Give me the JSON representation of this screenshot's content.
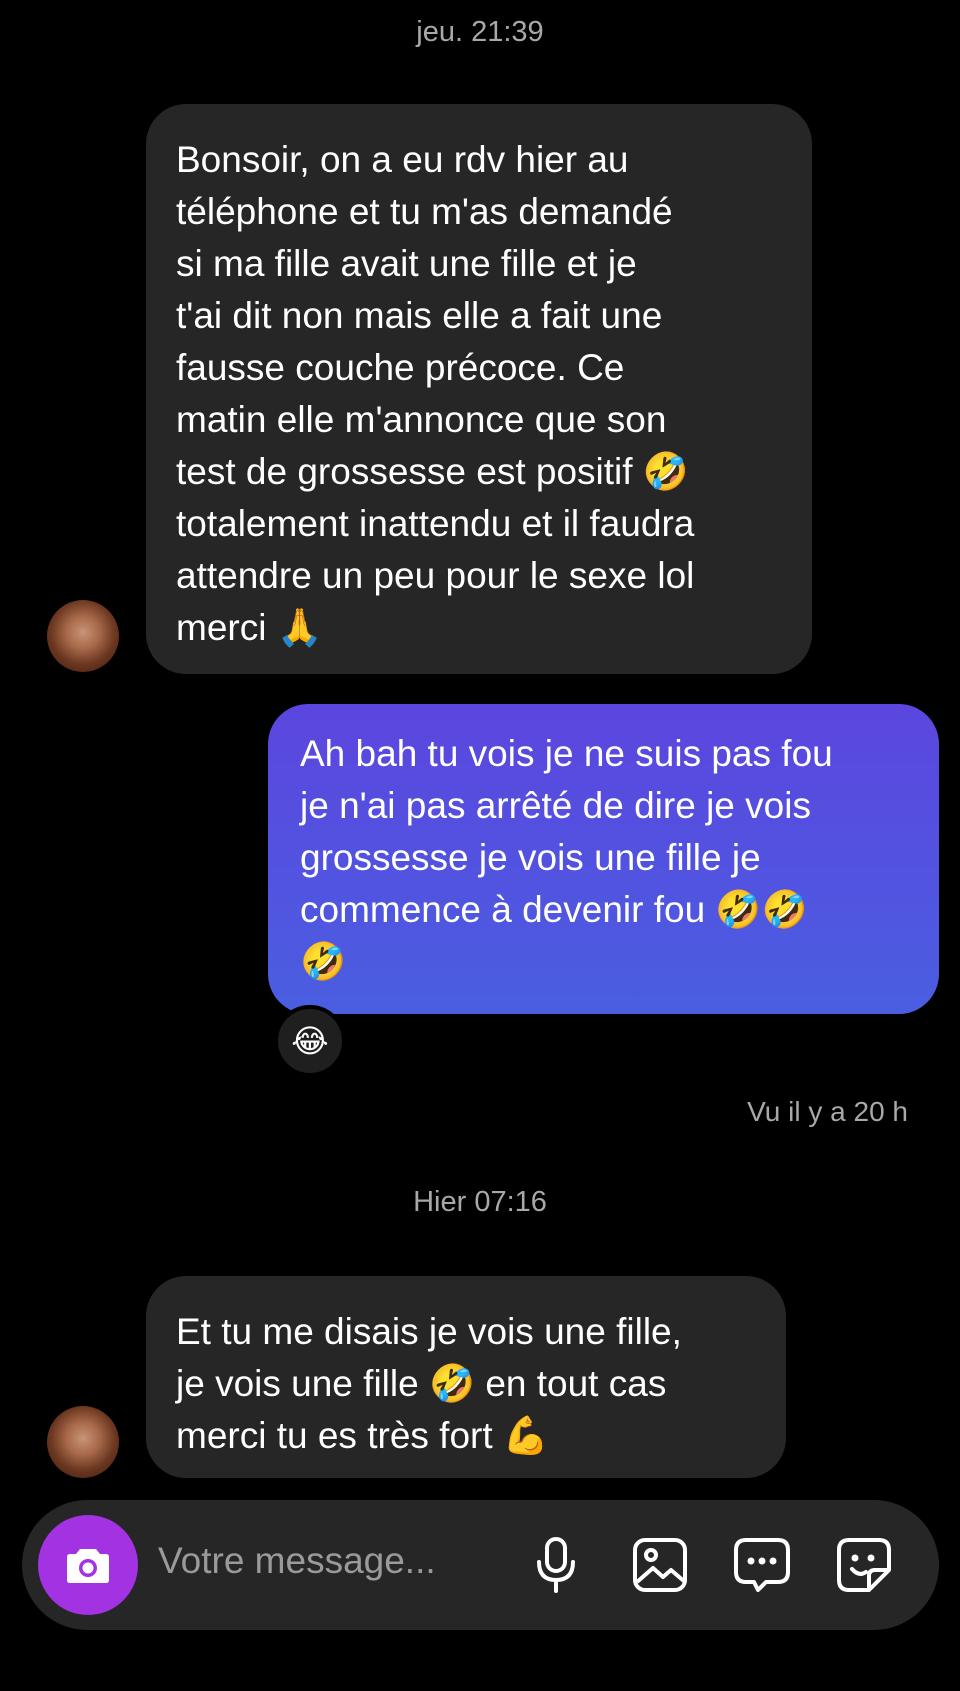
{
  "thread": {
    "timestamp_1": "jeu. 21:39",
    "timestamp_2": "Hier 07:16",
    "seen_status": "Vu il y a 20 h"
  },
  "messages": [
    {
      "direction": "incoming",
      "text": "Bonsoir, on a eu rdv hier au\ntéléphone et tu m'as demandé\nsi ma fille avait une fille et je\nt'ai dit non mais elle a fait une\nfausse couche précoce. Ce\nmatin elle m'annonce que son\ntest de grossesse est positif 🤣\ntotalement inattendu et il faudra\nattendre un peu pour le sexe lol\nmerci 🙏"
    },
    {
      "direction": "outgoing",
      "text": "Ah bah tu vois je ne suis pas fou\nje n'ai pas arrêté de dire je vois\ngrossesse je vois une fille je\ncommence à devenir fou 🤣🤣\n🤣",
      "reaction": "😂"
    },
    {
      "direction": "incoming",
      "text": "Et tu me disais je vois une fille,\nje vois une fille 🤣 en tout cas\nmerci tu es très fort 💪"
    }
  ],
  "composer": {
    "placeholder": "Votre message...",
    "icons": [
      "camera-icon",
      "microphone-icon",
      "image-icon",
      "chat-bubble-icon",
      "sticker-icon"
    ],
    "camera_color": "#a232e2"
  },
  "colors": {
    "background": "#000000",
    "incoming_bubble": "#262626",
    "outgoing_bubble_top": "#5b46df",
    "outgoing_bubble_bottom": "#4a5ee0"
  }
}
